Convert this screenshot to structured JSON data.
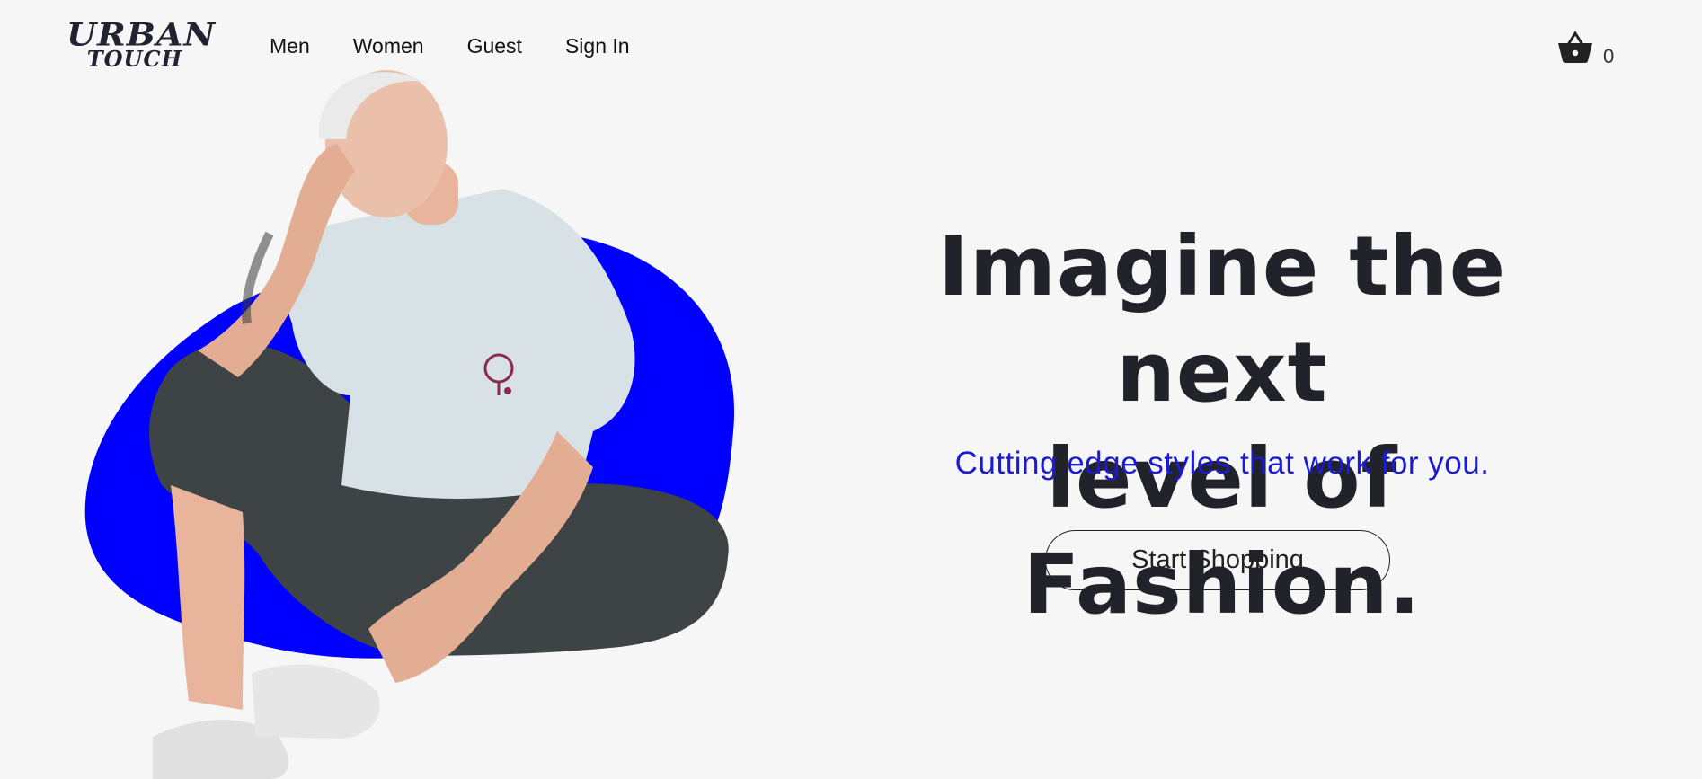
{
  "brand": {
    "line1": "URBAN",
    "line2": "TOUCH"
  },
  "nav": {
    "items": [
      {
        "label": "Men"
      },
      {
        "label": "Women"
      },
      {
        "label": "Guest"
      },
      {
        "label": "Sign In"
      }
    ]
  },
  "cart": {
    "icon": "basket-icon",
    "count": "0"
  },
  "hero": {
    "title_line1": "Imagine the next",
    "title_line2": "level of Fashion.",
    "subtitle": "Cutting edge styles that work for you.",
    "cta_label": "Start Shopping",
    "image_alt": "Model in white t-shirt and dark jeans seated in front of blue shape"
  },
  "colors": {
    "accent_blue": "#0000ff",
    "subtitle_blue": "#1b1bd4",
    "background": "#f6f6f6",
    "text_dark": "#22222a"
  }
}
